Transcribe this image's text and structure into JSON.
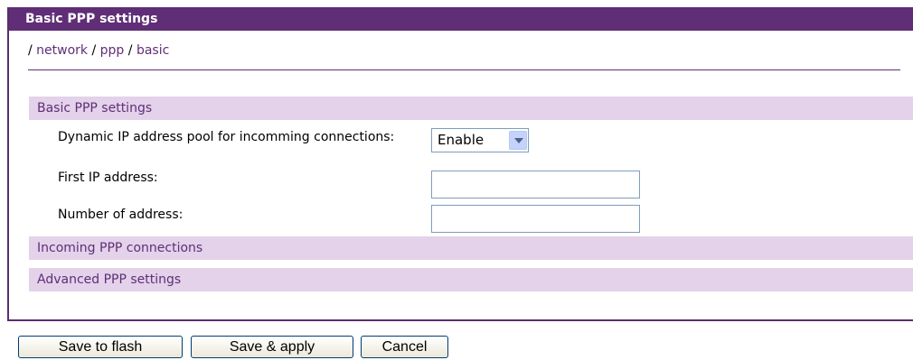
{
  "header": {
    "title": "Basic PPP settings"
  },
  "breadcrumb": {
    "root_sep": "/",
    "items": [
      {
        "label": "network"
      },
      {
        "label": "ppp"
      },
      {
        "label": "basic"
      }
    ],
    "sep": "/"
  },
  "sections": {
    "basic": {
      "title": "Basic PPP settings"
    },
    "incoming": {
      "title": "Incoming PPP connections"
    },
    "advanced": {
      "title": "Advanced PPP settings"
    }
  },
  "fields": {
    "pool": {
      "label": "Dynamic IP address pool for incomming connections:",
      "value": "Enable"
    },
    "first_ip": {
      "label": "First IP address:",
      "value": ""
    },
    "count": {
      "label": "Number of address:",
      "value": ""
    }
  },
  "buttons": {
    "save_flash": "Save to flash",
    "save_apply": "Save & apply",
    "cancel": "Cancel"
  },
  "colors": {
    "header_bg": "#5f2e76",
    "section_bg": "#e3d2ea",
    "link": "#5f2e76"
  }
}
